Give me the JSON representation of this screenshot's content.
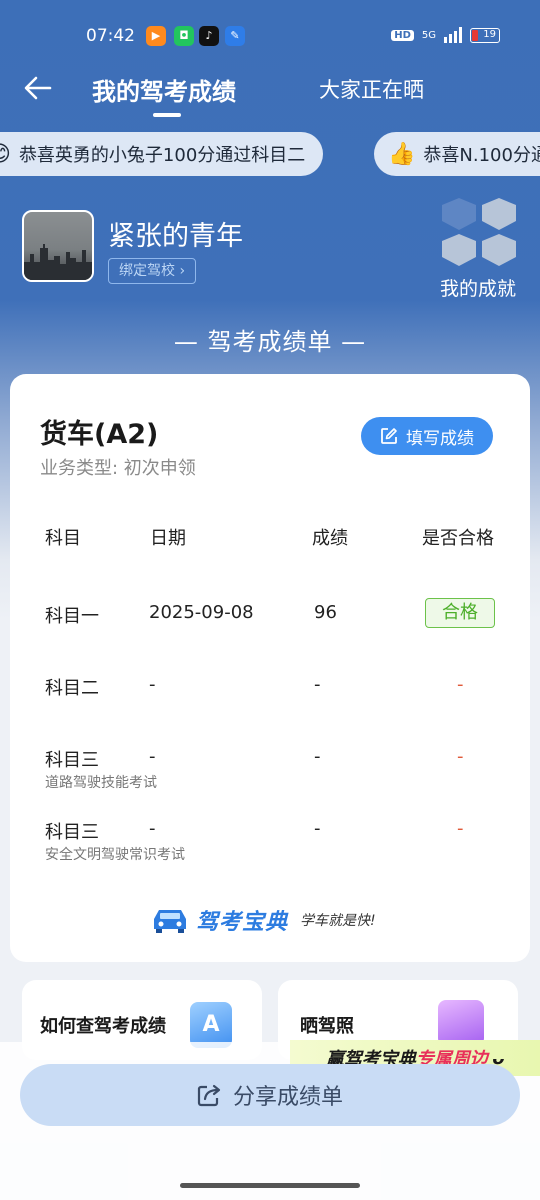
{
  "status_bar": {
    "time": "07:42",
    "hd": "HD",
    "network": "5G",
    "battery": "19"
  },
  "nav": {
    "active_tab": "我的驾考成绩",
    "other_tab": "大家正在晒"
  },
  "ticker": {
    "items": [
      "恭喜英勇的小兔子100分通过科目二",
      "恭喜N.100分通"
    ]
  },
  "profile": {
    "username": "紧张的青年",
    "bind_school": "绑定驾校",
    "achievements_label": "我的成就"
  },
  "report": {
    "title": "— 驾考成绩单 —",
    "vehicle": "货车(A2)",
    "business_type": "业务类型:  初次申领",
    "fill_button": "填写成绩",
    "headers": {
      "subject": "科目",
      "date": "日期",
      "score": "成绩",
      "passed": "是否合格"
    },
    "rows": [
      {
        "subject": "科目一",
        "note": "",
        "date": "2025-09-08",
        "score": "96",
        "passed": "合格"
      },
      {
        "subject": "科目二",
        "note": "",
        "date": "-",
        "score": "-",
        "passed": "-"
      },
      {
        "subject": "科目三",
        "note": "道路驾驶技能考试",
        "date": "-",
        "score": "-",
        "passed": "-"
      },
      {
        "subject": "科目三",
        "note": "安全文明驾驶常识考试",
        "date": "-",
        "score": "-",
        "passed": "-"
      }
    ],
    "brand_name": "驾考宝典",
    "brand_slogan": "学车就是快!"
  },
  "help_cards": {
    "how_to_check": "如何查驾考成绩",
    "show_license": "晒驾照"
  },
  "promo": {
    "prefix": "赢驾考宝典",
    "highlight": "专属周边"
  },
  "share_button": "分享成绩单",
  "colors": {
    "primary_blue": "#3d6fb8",
    "button_blue": "#3e8ff0",
    "pass_green": "#4caf2a",
    "dash_red": "#e05a3a"
  }
}
